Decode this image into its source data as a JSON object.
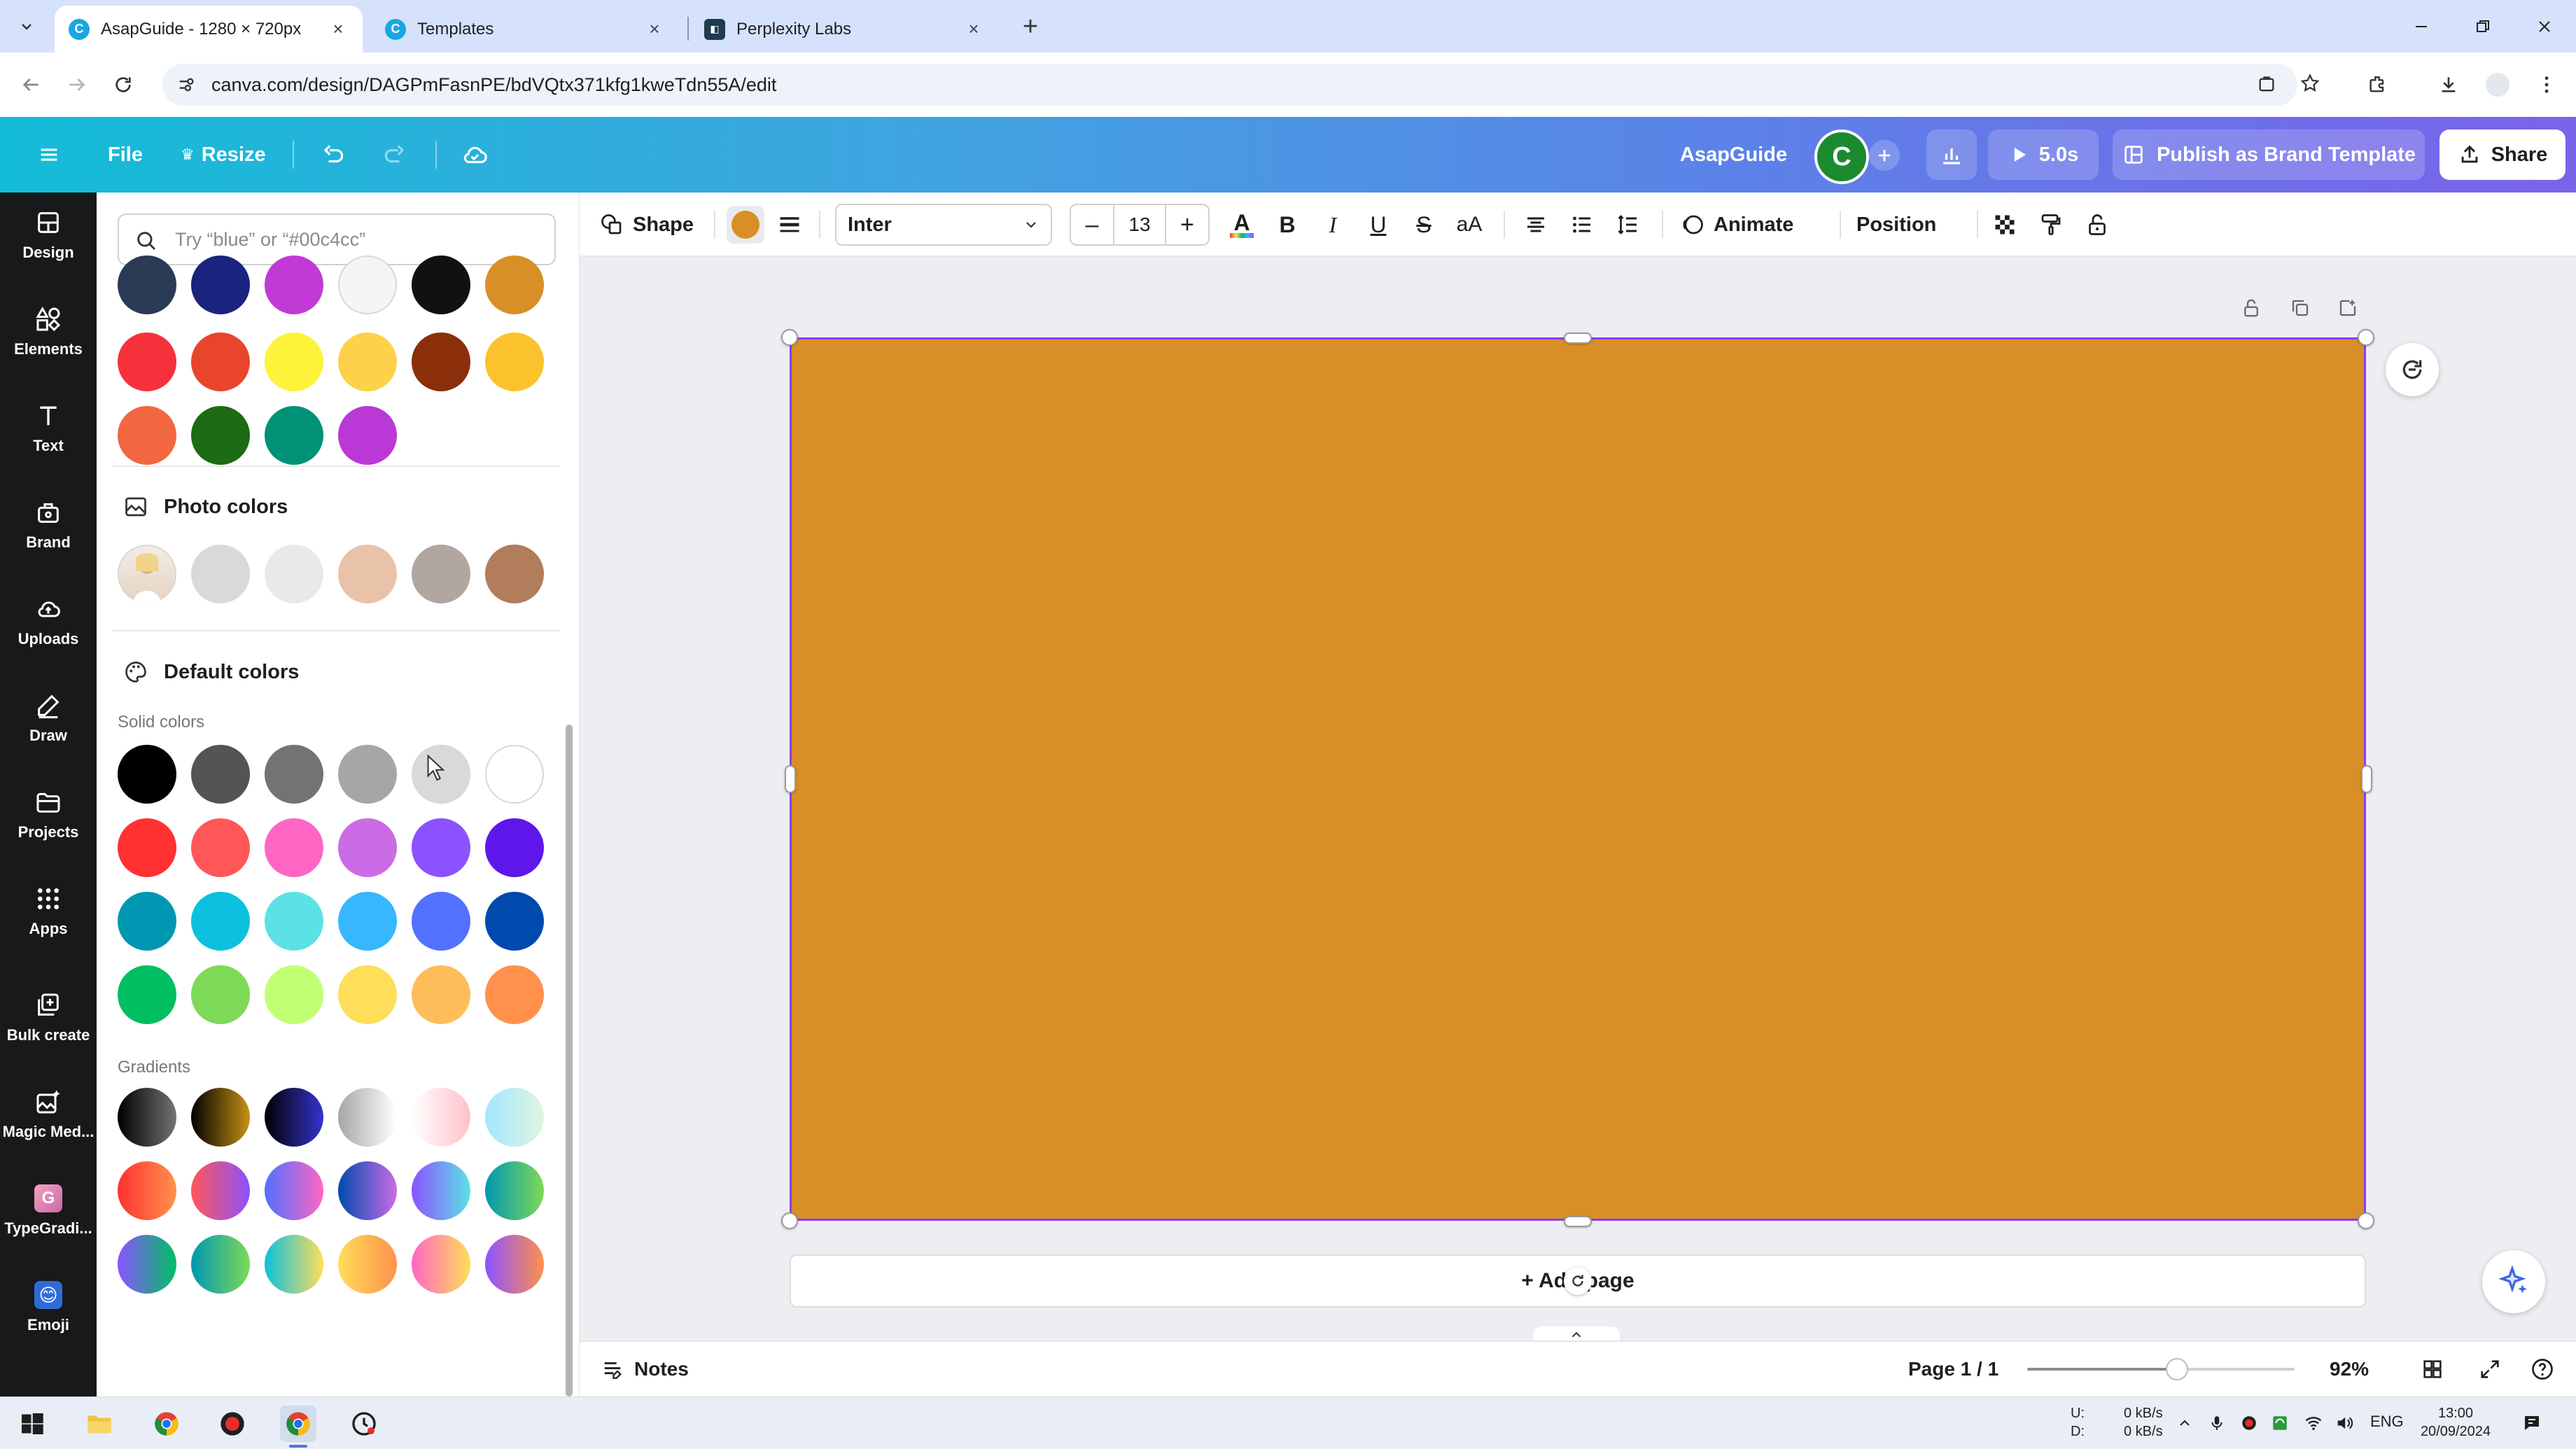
{
  "browser": {
    "tabs": [
      {
        "title": "AsapGuide - 1280 × 720px",
        "active": true
      },
      {
        "title": "Templates",
        "active": false
      },
      {
        "title": "Perplexity Labs",
        "active": false
      }
    ],
    "url": "canva.com/design/DAGPmFasnPE/bdVQtx371kfg1kweTdn55A/edit"
  },
  "header": {
    "file_label": "File",
    "resize_label": "Resize",
    "project_name": "AsapGuide",
    "avatar_letter": "C",
    "duration_label": "5.0s",
    "publish_label": "Publish as Brand Template",
    "share_label": "Share"
  },
  "rail": [
    {
      "label": "Design",
      "icon": "design-icon"
    },
    {
      "label": "Elements",
      "icon": "elements-icon"
    },
    {
      "label": "Text",
      "icon": "text-icon"
    },
    {
      "label": "Brand",
      "icon": "brand-icon"
    },
    {
      "label": "Uploads",
      "icon": "uploads-icon"
    },
    {
      "label": "Draw",
      "icon": "draw-icon"
    },
    {
      "label": "Projects",
      "icon": "projects-icon"
    },
    {
      "label": "Apps",
      "icon": "apps-icon"
    },
    {
      "label": "Bulk create",
      "icon": "bulk-create-icon"
    },
    {
      "label": "Magic Med...",
      "icon": "magic-media-icon"
    },
    {
      "label": "TypeGradi...",
      "icon": "typegradient-icon"
    },
    {
      "label": "Emoji",
      "icon": "emoji-icon"
    }
  ],
  "panel": {
    "search_placeholder": "Try “blue” or “#00c4cc”",
    "document_colors_row_partial": [
      "#2b3a55",
      "#1a237e",
      "#c13ad6",
      "#f5f5f5",
      "#111111",
      "#d98f27"
    ],
    "document_colors": [
      [
        "#f5313c",
        "#e8452c",
        "#fff23a",
        "#fdd14a",
        "#8a2f0a",
        "#fcc22d"
      ],
      [
        "#f26640",
        "#1d6b12",
        "#009177",
        "#b938d6"
      ]
    ],
    "photo_colors_title": "Photo colors",
    "photo_colors": [
      "#d9d9d9",
      "#e9e9e9",
      "#e9c3a9",
      "#b2a6a1",
      "#b17d5a"
    ],
    "default_colors_title": "Default colors",
    "solid_colors_label": "Solid colors",
    "solid_colors": [
      [
        "#000000",
        "#545454",
        "#737373",
        "#a6a6a6",
        "#d9d9d9",
        "#ffffff"
      ],
      [
        "#ff3131",
        "#ff5757",
        "#ff66c4",
        "#cb6ce6",
        "#8c52ff",
        "#5e17eb"
      ],
      [
        "#0097b2",
        "#0cc0df",
        "#5ce1e6",
        "#38b6ff",
        "#5271ff",
        "#004aad"
      ],
      [
        "#00bf63",
        "#7ed957",
        "#c1ff72",
        "#ffde59",
        "#ffbd59",
        "#ff914d"
      ]
    ],
    "gradients_label": "Gradients",
    "gradients": [
      [
        [
          "#000000",
          "#737373"
        ],
        [
          "#000000",
          "#c89116"
        ],
        [
          "#000000",
          "#3533cd"
        ],
        [
          "#a6a6a6",
          "#ffffff"
        ],
        [
          "#ffffff",
          "#ffc0cb"
        ],
        [
          "#a2e6ff",
          "#e0f4e0"
        ]
      ],
      [
        [
          "#ff3131",
          "#ff914d"
        ],
        [
          "#ff5757",
          "#8c52ff"
        ],
        [
          "#5170ff",
          "#ff66c4"
        ],
        [
          "#004aad",
          "#cb6ce6"
        ],
        [
          "#8c52ff",
          "#5ce1e6"
        ],
        [
          "#0097b2",
          "#7ed957"
        ]
      ],
      [
        [
          "#8c52ff",
          "#00bf63"
        ],
        [
          "#0097b2",
          "#7ed957"
        ],
        [
          "#0cc0df",
          "#ffde59"
        ],
        [
          "#ffde59",
          "#ff914d"
        ],
        [
          "#ff66c4",
          "#ffde59"
        ],
        [
          "#8c52ff",
          "#ff914d"
        ]
      ]
    ]
  },
  "toolbar": {
    "shape_label": "Shape",
    "fill_color": "#d98f27",
    "font_name": "Inter",
    "font_size": "13",
    "bold_glyph": "B",
    "italic_glyph": "I",
    "underline_glyph": "U",
    "strike_glyph": "S",
    "case_glyph": "aA",
    "animate_label": "Animate",
    "position_label": "Position"
  },
  "canvas": {
    "shape_color": "#d98f27",
    "selection_color": "#8b3dff",
    "add_page_label": "+ Add page"
  },
  "footer": {
    "notes_label": "Notes",
    "page_indicator": "Page 1 / 1",
    "zoom_value": 0.56,
    "zoom_label": "92%"
  },
  "taskbar": {
    "net_up_label": "U:",
    "net_down_label": "D:",
    "net_up_value": "0 kB/s",
    "net_down_value": "0 kB/s",
    "language": "ENG",
    "time": "13:00",
    "date": "20/09/2024"
  }
}
